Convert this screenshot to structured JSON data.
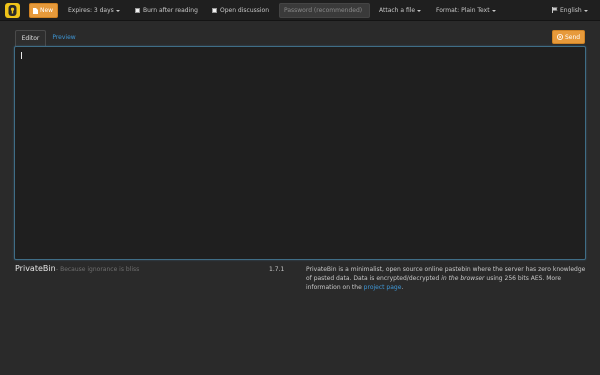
{
  "navbar": {
    "new_label": "New",
    "expires_label": "Expires: 3 days",
    "burn_label": "Burn after reading",
    "discussion_label": "Open discussion",
    "password_placeholder": "Password (recommended)",
    "attach_label": "Attach a file",
    "format_label": "Format: Plain Text",
    "language_label": "English"
  },
  "editor": {
    "tab_editor": "Editor",
    "tab_preview": "Preview",
    "send_label": "Send",
    "content": ""
  },
  "footer": {
    "brand": "PrivateBin",
    "tagline": "- Because ignorance is bliss",
    "version": "1.7.1",
    "about_1": "PrivateBin is a minimalist, open source online pastebin where the server has zero knowledge of pasted data. Data is encrypted/decrypted ",
    "about_em": "in the browser",
    "about_2": " using 256 bits AES. More information on the ",
    "about_link": "project page",
    "about_3": "."
  },
  "colors": {
    "accent": "#e79a3b",
    "link": "#3f98d8",
    "background": "#2a2a2a",
    "navbar": "#1f1f1f",
    "editor_bg": "#1f1f1f"
  },
  "icons": {
    "logo": "privatebin-lock-logo",
    "new": "file-icon",
    "send": "send-arrow-icon",
    "language": "flag-icon"
  }
}
